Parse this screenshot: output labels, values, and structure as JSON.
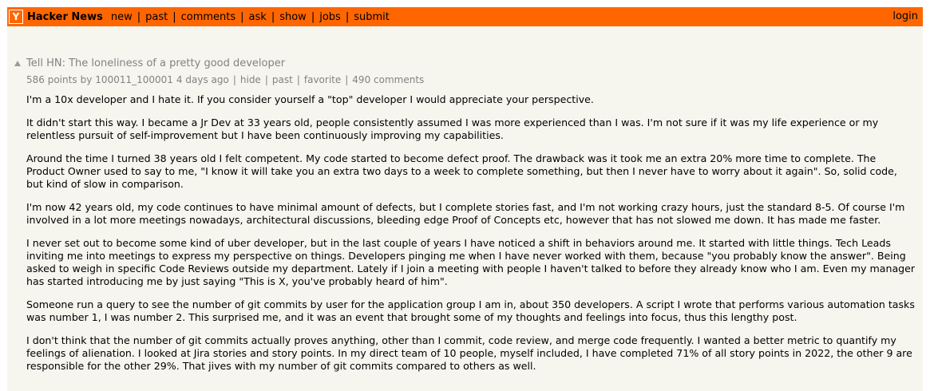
{
  "header": {
    "logo_letter": "Y",
    "site_name": "Hacker News",
    "nav": [
      "new",
      "past",
      "comments",
      "ask",
      "show",
      "jobs",
      "submit"
    ],
    "login": "login"
  },
  "story": {
    "title": "Tell HN: The loneliness of a pretty good developer",
    "points": "586 points",
    "by": "by",
    "user": "100011_100001",
    "age": "4 days ago",
    "hide": "hide",
    "past": "past",
    "favorite": "favorite",
    "comments": "490 comments"
  },
  "paragraphs": [
    "I'm a 10x developer and I hate it. If you consider yourself a \"top\" developer I would appreciate your perspective.",
    "It didn't start this way. I became a Jr Dev at 33 years old, people consistently assumed I was more experienced than I was. I'm not sure if it was my life experience or my relentless pursuit of self-improvement but I have been continuously improving my capabilities.",
    "Around the time I turned 38 years old I felt competent. My code started to become defect proof. The drawback was it took me an extra 20% more time to complete. The Product Owner used to say to me, \"I know it will take you an extra two days to a week to complete something, but then I never have to worry about it again\". So, solid code, but kind of slow in comparison.",
    "I'm now 42 years old, my code continues to have minimal amount of defects, but I complete stories fast, and I'm not working crazy hours, just the standard 8-5. Of course I'm involved in a lot more meetings nowadays, architectural discussions, bleeding edge Proof of Concepts etc, however that has not slowed me down. It has made me faster.",
    "I never set out to become some kind of uber developer, but in the last couple of years I have noticed a shift in behaviors around me. It started with little things. Tech Leads inviting me into meetings to express my perspective on things. Developers pinging me when I have never worked with them, because \"you probably know the answer\". Being asked to weigh in specific Code Reviews outside my department. Lately if I join a meeting with people I haven't talked to before they already know who I am. Even my manager has started introducing me by just saying \"This is X, you've probably heard of him\".",
    "Someone run a query to see the number of git commits by user for the application group I am in, about 350 developers. A script I wrote that performs various automation tasks was number 1, I was number 2. This surprised me, and it was an event that brought some of my thoughts and feelings into focus, thus this lengthy post.",
    "I don't think that the number of git commits actually proves anything, other than I commit, code review, and merge code frequently. I wanted a better metric to quantify my feelings of alienation. I looked at Jira stories and story points. In my direct team of 10 people, myself included, I have completed 71% of all story points in 2022, the other 9 are responsible for the other 29%. That jives with my number of git commits compared to others as well."
  ]
}
